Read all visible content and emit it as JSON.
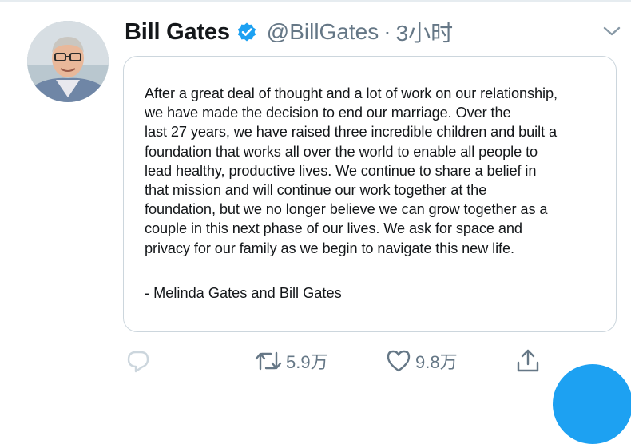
{
  "tweet": {
    "display_name": "Bill Gates",
    "handle": "@BillGates",
    "separator": "·",
    "time": "3小时",
    "statement_lines": [
      "After a great deal of thought and a lot of work on our relationship,",
      "we have made the decision to end our marriage. Over the",
      "last 27 years, we have raised three incredible children and built a",
      "foundation that works all over the world to enable all people to",
      "lead healthy, productive lives. We continue to share a belief in",
      "that mission and will continue our work together at the",
      "foundation, but we no longer believe we can grow together as a",
      "couple in this next phase of our lives. We ask for space and",
      "privacy for our family as we begin to navigate this new life."
    ],
    "signature": "- Melinda Gates and Bill Gates"
  },
  "actions": {
    "reply": {
      "icon": "reply-icon"
    },
    "retweet": {
      "icon": "retweet-icon",
      "count": "5.9万"
    },
    "like": {
      "icon": "heart-icon",
      "count": "9.8万"
    },
    "share": {
      "icon": "share-icon"
    }
  },
  "icons": {
    "verified": "verified-badge-icon",
    "more": "chevron-down-icon"
  },
  "colors": {
    "text_primary": "#14171a",
    "text_secondary": "#657786",
    "accent": "#1da1f2",
    "card_border": "#ccd6dd",
    "reply_icon": "#ccd6dd"
  }
}
